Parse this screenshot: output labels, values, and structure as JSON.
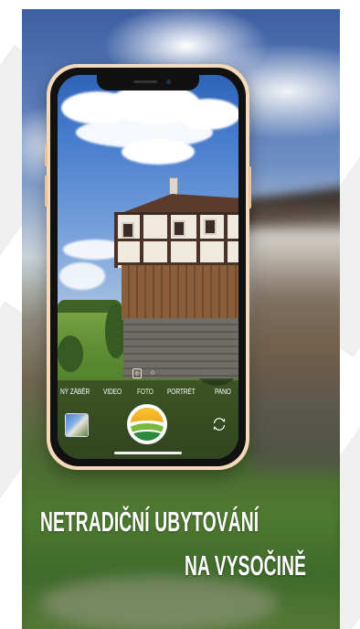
{
  "camera": {
    "modes": [
      {
        "label": "NÝ ZÁBĚR"
      },
      {
        "label": "VIDEO"
      },
      {
        "label": "FOTO"
      },
      {
        "label": "PORTRÉT"
      },
      {
        "label": "PANO"
      }
    ],
    "active_mode": "FOTO",
    "icons": {
      "shutter": "shutter-logo-icon",
      "switch_camera": "rotate-camera-icon",
      "gallery": "gallery-thumbnail"
    }
  },
  "headline": {
    "line1": "NETRADIČNÍ UBYTOVÁNÍ",
    "line2": "NA VYSOČINĚ"
  },
  "colors": {
    "phone_frame": "#f6d9b8",
    "logo_sun": "#f7c531",
    "logo_green": "#2c8a3a",
    "headline": "#ffffff"
  }
}
